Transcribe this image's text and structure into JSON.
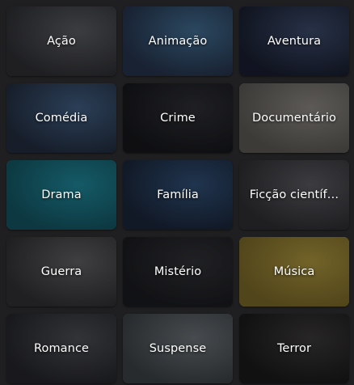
{
  "genres": [
    {
      "label": "Ação",
      "art": "#5a5c60,#2c2d30"
    },
    {
      "label": "Animação",
      "art": "#3f6e93,#22314a"
    },
    {
      "label": "Aventura",
      "art": "#39496a,#151b2c"
    },
    {
      "label": "Comédia",
      "art": "#3f5f84,#1f2b3d"
    },
    {
      "label": "Crime",
      "art": "#2c2d31,#121316"
    },
    {
      "label": "Documentário",
      "art": "#8f8b84,#5c5953"
    },
    {
      "label": "Drama",
      "art": "#1b8c9e,#0f5561"
    },
    {
      "label": "Família",
      "art": "#2d4f77,#162236"
    },
    {
      "label": "Ficção científ…",
      "art": "#5b5b60,#2c2c2f"
    },
    {
      "label": "Guerra",
      "art": "#606062,#2e2e30"
    },
    {
      "label": "Mistério",
      "art": "#2e2f32,#16171a"
    },
    {
      "label": "Música",
      "art": "#b29a3a,#7d6a24"
    },
    {
      "label": "Romance",
      "art": "#4b4d52,#222327"
    },
    {
      "label": "Suspense",
      "art": "#6c7377,#3a4043"
    },
    {
      "label": "Terror",
      "art": "#3a3836,#161514"
    }
  ]
}
